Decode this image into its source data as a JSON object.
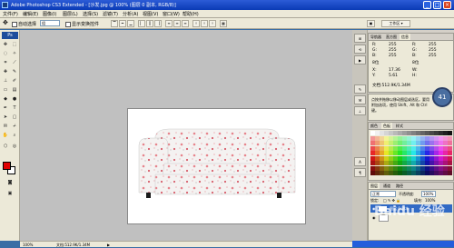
{
  "window": {
    "title": "Adobe Photoshop CS3 Extended - [沙发.jpg @ 100% (图层 0 副本, RGB/8)]"
  },
  "menu": [
    "文件(F)",
    "编辑(E)",
    "图像(I)",
    "图层(L)",
    "选择(S)",
    "滤镜(T)",
    "分析(A)",
    "视图(V)",
    "窗口(W)",
    "帮助(H)"
  ],
  "options": {
    "auto_select_label": "自动选择",
    "auto_select_value": "组",
    "show_transform_label": "显示变换控件",
    "workspace_label": "工作区"
  },
  "toolbox": {
    "logo": "Ps",
    "fg_color": "#e00000",
    "bg_color": "#ffffff"
  },
  "info_panel": {
    "tabs": [
      "导航器",
      "直方图",
      "信息"
    ],
    "rgb_left": {
      "R": "255",
      "G": "255",
      "B": "255"
    },
    "rgb_right": {
      "R": "255",
      "G": "255",
      "B": "255"
    },
    "depth_left": "8位",
    "depth_right": "8位",
    "x": "17.36",
    "y": "5.61",
    "doc": "文档:512.9K/1.34M",
    "hint": "点按并拖移以移动图层或选区。要用附加选项，使用 Shift、Alt 和 Ctrl 键。"
  },
  "speed_indicator": "41",
  "color_panel": {
    "tabs": [
      "颜色",
      "色板",
      "样式"
    ]
  },
  "layers_panel": {
    "tabs": [
      "图层",
      "通道",
      "路径"
    ],
    "blend_mode": "正常",
    "opacity_label": "不透明度:",
    "opacity": "100%",
    "lock_label": "锁定:",
    "fill_label": "填充:",
    "fill": "100%",
    "layer_name": "图层 0 副本"
  },
  "status": {
    "zoom": "100%",
    "doc": "文档:512.9K/1.34M"
  },
  "watermark": "Baidu 经验"
}
